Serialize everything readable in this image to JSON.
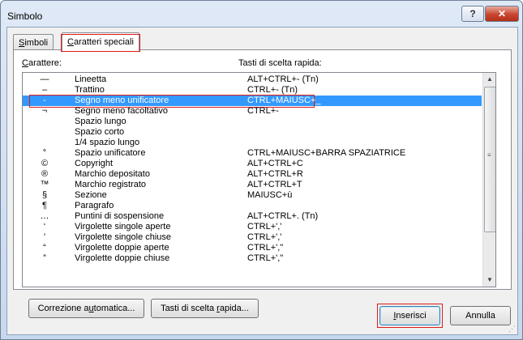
{
  "window": {
    "title": "Simbolo",
    "help_label": "?",
    "close_label": "✕"
  },
  "tabs": [
    {
      "label_pre": "",
      "label_u": "S",
      "label_post": "imboli",
      "active": false
    },
    {
      "label_pre": "",
      "label_u": "C",
      "label_post": "aratteri speciali",
      "active": true
    }
  ],
  "headers": {
    "character_pre": "",
    "character_u": "C",
    "character_post": "arattere:",
    "shortcut": "Tasti di scelta rapida:"
  },
  "rows": [
    {
      "char": "—",
      "name": "Lineetta",
      "shortcut": "ALT+CTRL+- (Tn)"
    },
    {
      "char": "–",
      "name": "Trattino",
      "shortcut": "CTRL+- (Tn)"
    },
    {
      "char": "-",
      "name": "Segno meno unificatore",
      "shortcut": "CTRL+MAIUSC+_",
      "selected": true
    },
    {
      "char": "¬",
      "name": "Segno meno facoltativo",
      "shortcut": "CTRL+-"
    },
    {
      "char": "",
      "name": "Spazio lungo",
      "shortcut": ""
    },
    {
      "char": "",
      "name": "Spazio corto",
      "shortcut": ""
    },
    {
      "char": "",
      "name": "1/4  spazio lungo",
      "shortcut": ""
    },
    {
      "char": "°",
      "name": "Spazio unificatore",
      "shortcut": "CTRL+MAIUSC+BARRA SPAZIATRICE"
    },
    {
      "char": "©",
      "name": "Copyright",
      "shortcut": "ALT+CTRL+C"
    },
    {
      "char": "®",
      "name": "Marchio depositato",
      "shortcut": "ALT+CTRL+R"
    },
    {
      "char": "™",
      "name": "Marchio registrato",
      "shortcut": "ALT+CTRL+T"
    },
    {
      "char": "§",
      "name": "Sezione",
      "shortcut": "MAIUSC+ù"
    },
    {
      "char": "¶",
      "name": "Paragrafo",
      "shortcut": ""
    },
    {
      "char": "…",
      "name": "Puntini di sospensione",
      "shortcut": "ALT+CTRL+. (Tn)"
    },
    {
      "char": "‘",
      "name": "Virgolette singole aperte",
      "shortcut": "CTRL+',' "
    },
    {
      "char": "’",
      "name": "Virgolette singole chiuse",
      "shortcut": "CTRL+','"
    },
    {
      "char": "“",
      "name": "Virgolette doppie aperte",
      "shortcut": "CTRL+',\""
    },
    {
      "char": "”",
      "name": "Virgolette doppie chiuse",
      "shortcut": "CTRL+',\""
    }
  ],
  "scrollbar": {
    "up_icon": "▲",
    "down_icon": "▼",
    "grip_icon": "≡"
  },
  "buttons": {
    "autocorrect_pre": "Correzione a",
    "autocorrect_u": "u",
    "autocorrect_post": "tomatica...",
    "shortcut_pre": "Tasti di scelta ",
    "shortcut_u": "r",
    "shortcut_post": "apida...",
    "insert_pre": "",
    "insert_u": "I",
    "insert_post": "nserisci",
    "cancel": "Annulla"
  },
  "colors": {
    "selection": "#3399ff",
    "focus_ring": "#e01a1a",
    "close_button": "#c9452e"
  }
}
